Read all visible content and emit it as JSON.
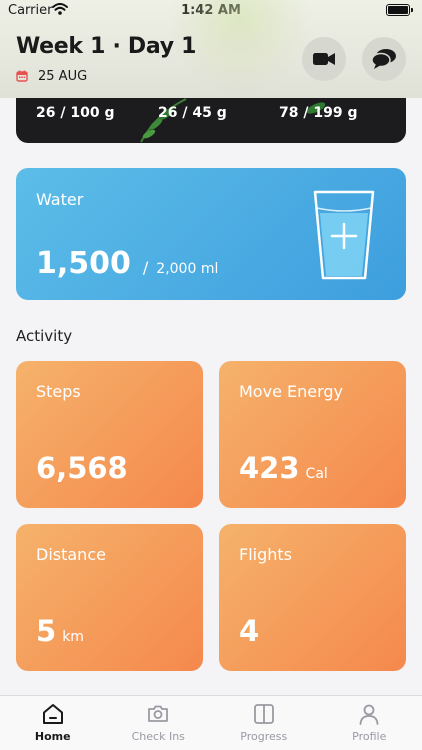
{
  "status": {
    "carrier": "Carrier",
    "time": "1:42 AM"
  },
  "header": {
    "title": "Week 1 · Day 1",
    "date": "25 AUG"
  },
  "meal": {
    "macros": [
      "26 / 100 g",
      "26 / 45 g",
      "78 / 199 g"
    ]
  },
  "water": {
    "title": "Water",
    "value": "1,500",
    "separator": "/",
    "goal": "2,000 ml",
    "progress": 0.75
  },
  "activity": {
    "title": "Activity",
    "tiles": [
      {
        "label": "Steps",
        "value": "6,568",
        "unit": ""
      },
      {
        "label": "Move Energy",
        "value": "423",
        "unit": "Cal"
      },
      {
        "label": "Distance",
        "value": "5",
        "unit": "km"
      },
      {
        "label": "Flights",
        "value": "4",
        "unit": ""
      }
    ]
  },
  "tabs": [
    {
      "label": "Home",
      "icon": "home-icon",
      "active": true
    },
    {
      "label": "Check Ins",
      "icon": "camera-icon",
      "active": false
    },
    {
      "label": "Progress",
      "icon": "progress-icon",
      "active": false
    },
    {
      "label": "Profile",
      "icon": "profile-icon",
      "active": false
    }
  ],
  "colors": {
    "accent_red": "#e8514f",
    "water_blue": "#3d9ede",
    "activity_orange": "#f59b5a"
  }
}
